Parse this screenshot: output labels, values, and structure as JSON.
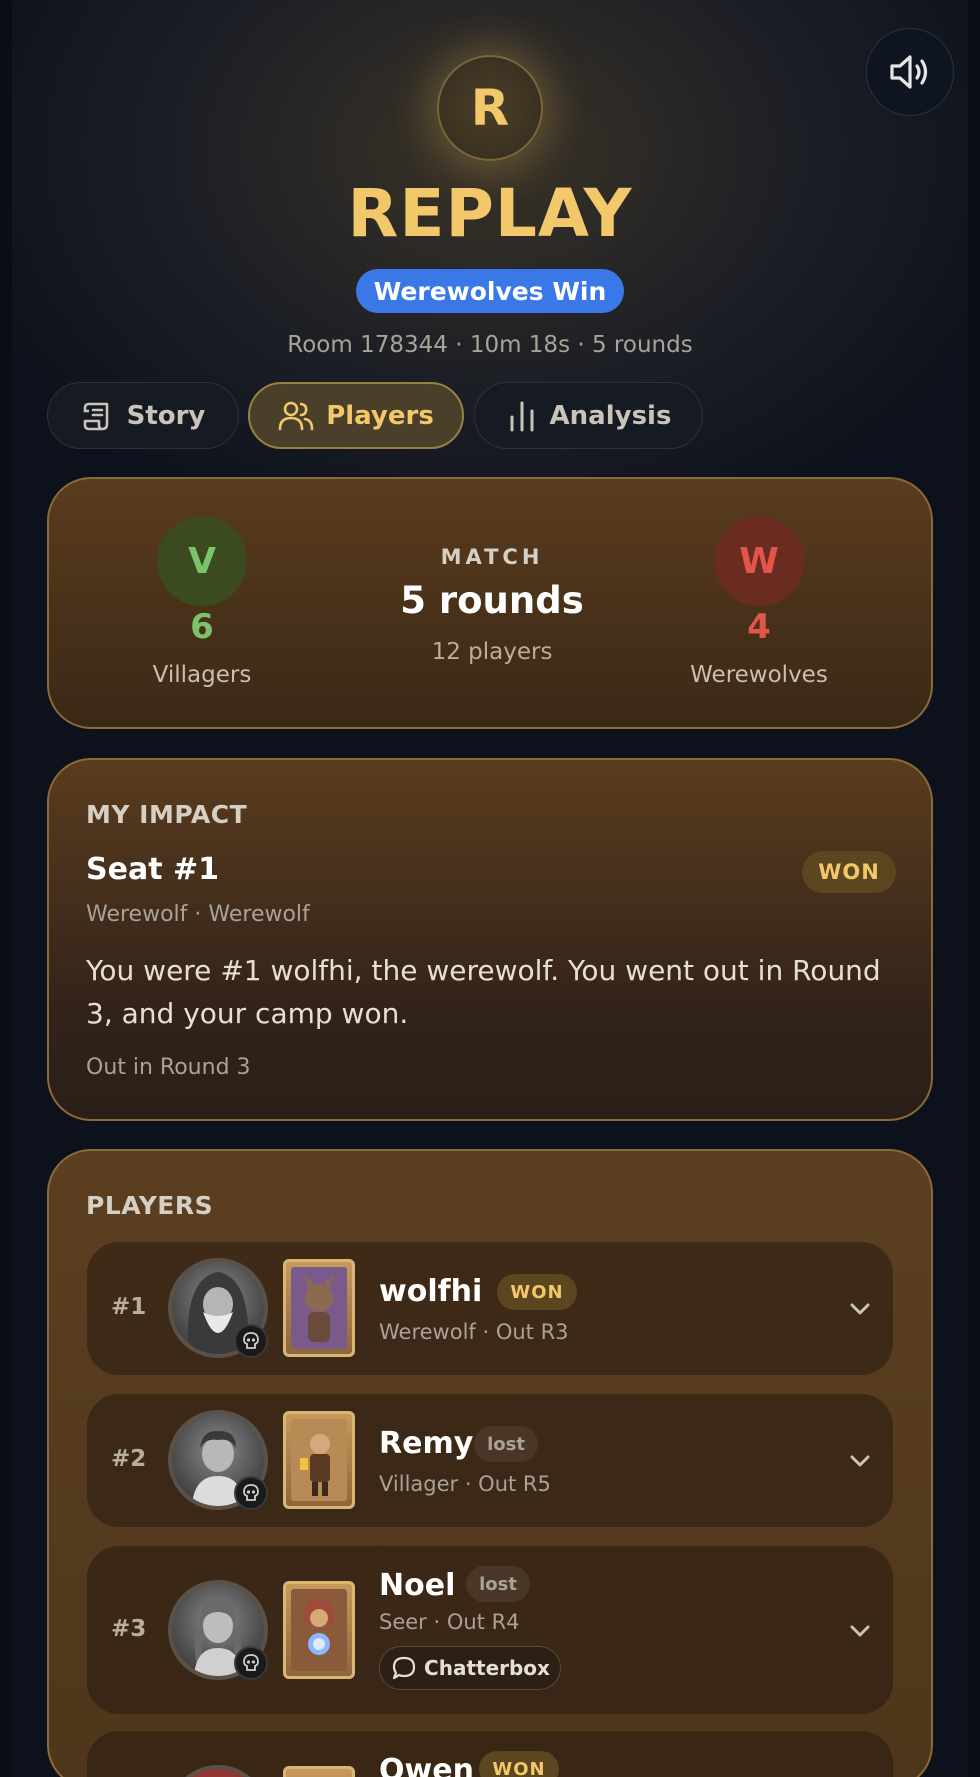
{
  "header": {
    "avatar_letter": "R",
    "title": "REPLAY",
    "result_pill": "Werewolves Win",
    "meta": "Room 178344 · 10m 18s · 5 rounds"
  },
  "tabs": [
    {
      "label": "Story",
      "icon": "scroll-icon",
      "active": false
    },
    {
      "label": "Players",
      "icon": "users-icon",
      "active": true
    },
    {
      "label": "Analysis",
      "icon": "bar-chart-icon",
      "active": false
    }
  ],
  "match": {
    "villagers": {
      "letter": "V",
      "count": "6",
      "label": "Villagers"
    },
    "werewolves": {
      "letter": "W",
      "count": "4",
      "label": "Werewolves"
    },
    "heading": "MATCH",
    "rounds": "5 rounds",
    "players": "12 players"
  },
  "impact": {
    "heading": "MY IMPACT",
    "seat": "Seat #1",
    "badge": "WON",
    "subtitle": "Werewolf · Werewolf",
    "summary": "You were #1 wolfhi, the werewolf. You went out in Round 3, and your camp won.",
    "footer": "Out in Round 3"
  },
  "players": {
    "heading": "PLAYERS",
    "rows": [
      {
        "seat": "#1",
        "name": "wolfhi",
        "result": "WON",
        "detail": "Werewolf · Out R3"
      },
      {
        "seat": "#2",
        "name": "Remy",
        "result": "lost",
        "detail": "Villager · Out R5"
      },
      {
        "seat": "#3",
        "name": "Noel",
        "result": "lost",
        "detail": "Seer · Out R4",
        "chip": "Chatterbox"
      },
      {
        "seat": "",
        "name": "Owen",
        "result": "WON",
        "detail": ""
      }
    ]
  },
  "colors": {
    "accent_gold": "#f3c86a",
    "win_blue": "#3b78e7",
    "villager_green": "#7cc46a",
    "werewolf_red": "#e0574a",
    "card_brown": "#5a3c1e"
  }
}
